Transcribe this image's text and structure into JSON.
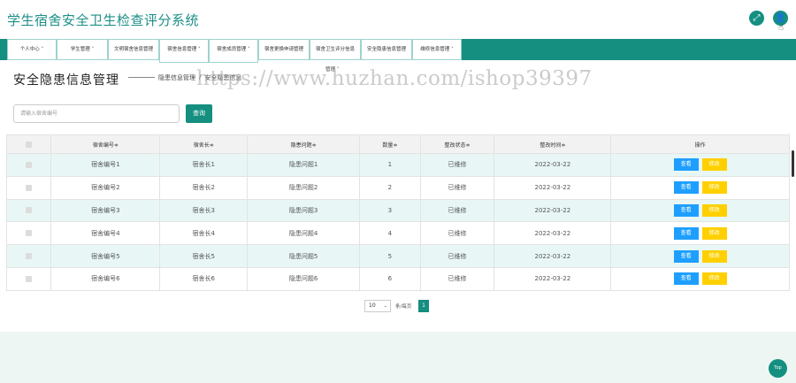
{
  "app": {
    "title": "学生宿舍安全卫生检查评分系统"
  },
  "header": {
    "expand_icon": "expand-icon",
    "user_icon": "user-icon",
    "expand_glyph": "⤢",
    "user_glyph": "👤"
  },
  "nav": {
    "items": [
      {
        "label": "个人中心 ˅"
      },
      {
        "label": "学生管理 ˅"
      },
      {
        "label": "文明宿舍信息管理"
      },
      {
        "label": "宿舍信息管理 ˅"
      },
      {
        "label": "宿舍成员管理 ˅"
      },
      {
        "label": "宿舍更换申请管理"
      },
      {
        "label": "宿舍卫生评分信息"
      },
      {
        "label": "安全隐患信息管理"
      },
      {
        "label": "维修信息管理 ˅"
      }
    ],
    "sub_label": "管理 ˅"
  },
  "page": {
    "title": "安全隐患信息管理",
    "breadcrumb": [
      "隐患信息管理",
      "安全隐患信息"
    ],
    "watermark": "https://www.huzhan.com/ishop39397"
  },
  "search": {
    "placeholder": "请输入宿舍编号",
    "button": "查询"
  },
  "table": {
    "headers": [
      "",
      "宿舍编号≑",
      "宿舍长≑",
      "隐患问题≑",
      "数量≑",
      "整改状态≑",
      "整改时间≑",
      "操作"
    ],
    "rows": [
      {
        "dorm": "宿舍编号1",
        "leader": "宿舍长1",
        "issue": "隐患问题1",
        "qty": "1",
        "status": "已维修",
        "date": "2022-03-22"
      },
      {
        "dorm": "宿舍编号2",
        "leader": "宿舍长2",
        "issue": "隐患问题2",
        "qty": "2",
        "status": "已维修",
        "date": "2022-03-22"
      },
      {
        "dorm": "宿舍编号3",
        "leader": "宿舍长3",
        "issue": "隐患问题3",
        "qty": "3",
        "status": "已维修",
        "date": "2022-03-22"
      },
      {
        "dorm": "宿舍编号4",
        "leader": "宿舍长4",
        "issue": "隐患问题4",
        "qty": "4",
        "status": "已维修",
        "date": "2022-03-22"
      },
      {
        "dorm": "宿舍编号5",
        "leader": "宿舍长5",
        "issue": "隐患问题5",
        "qty": "5",
        "status": "已维修",
        "date": "2022-03-22"
      },
      {
        "dorm": "宿舍编号6",
        "leader": "宿舍长6",
        "issue": "隐患问题6",
        "qty": "6",
        "status": "已维修",
        "date": "2022-03-22"
      }
    ],
    "view_label": "查看",
    "edit_label": "修改"
  },
  "pagination": {
    "page_size": "10",
    "per_page_label": "条/每页",
    "current_page": "1"
  },
  "top_button": "Top",
  "colors": {
    "primary": "#148f80",
    "view": "#1e9fff",
    "edit": "#ffd000",
    "row_alt": "#e8f7f6"
  }
}
